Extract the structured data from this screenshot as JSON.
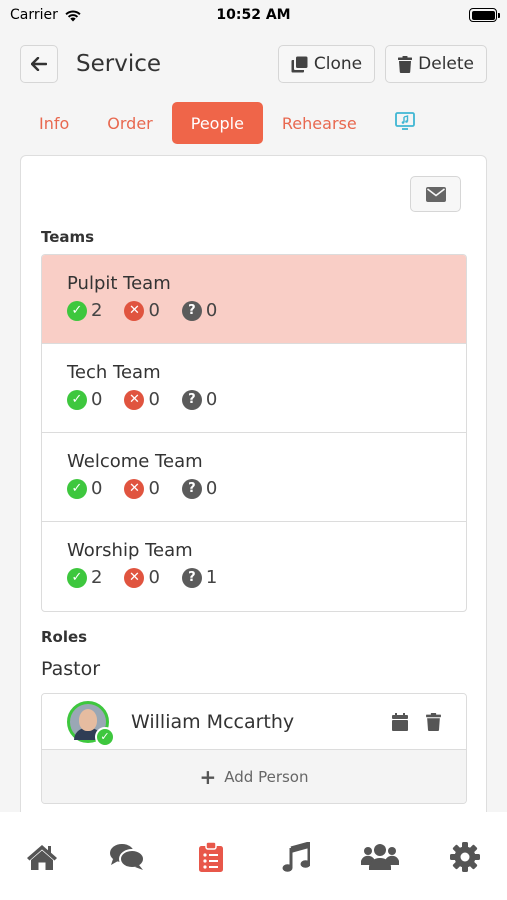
{
  "status_bar": {
    "carrier": "Carrier",
    "time": "10:52 AM"
  },
  "header": {
    "title": "Service",
    "clone_label": "Clone",
    "delete_label": "Delete"
  },
  "tabs": [
    {
      "label": "Info",
      "active": false
    },
    {
      "label": "Order",
      "active": false
    },
    {
      "label": "People",
      "active": true
    },
    {
      "label": "Rehearse",
      "active": false
    }
  ],
  "teams_label": "Teams",
  "teams": [
    {
      "name": "Pulpit Team",
      "accepted": "2",
      "declined": "0",
      "pending": "0",
      "selected": true
    },
    {
      "name": "Tech Team",
      "accepted": "0",
      "declined": "0",
      "pending": "0",
      "selected": false
    },
    {
      "name": "Welcome Team",
      "accepted": "0",
      "declined": "0",
      "pending": "0",
      "selected": false
    },
    {
      "name": "Worship Team",
      "accepted": "2",
      "declined": "0",
      "pending": "1",
      "selected": false
    }
  ],
  "roles_label": "Roles",
  "role": {
    "name": "Pastor",
    "person": "William Mccarthy",
    "add_label": "Add Person"
  },
  "colors": {
    "accent": "#ef6549",
    "selected_bg": "#f9cec6",
    "ok": "#3ec73e",
    "no": "#e0543f"
  },
  "icons": [
    "back-arrow-icon",
    "clone-icon",
    "trash-icon",
    "practice-icon",
    "envelope-icon",
    "calendar-icon",
    "home-icon",
    "chat-icon",
    "clipboard-icon",
    "music-icon",
    "users-icon",
    "gear-icon"
  ]
}
